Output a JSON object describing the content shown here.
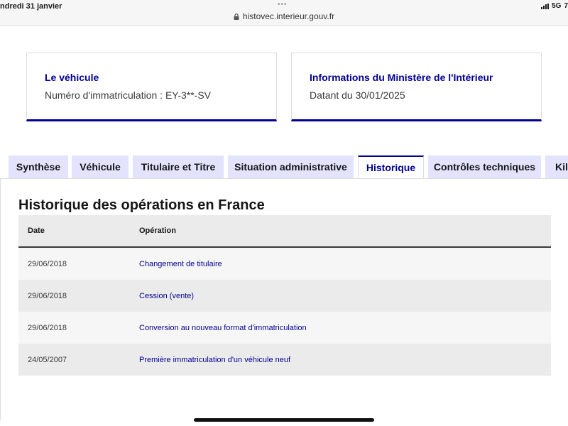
{
  "statusbar": {
    "time": "ndredi 31 janvier",
    "dots": "•••",
    "url": "histovec.interieur.gouv.fr",
    "network": "5G",
    "battery": "7"
  },
  "cards": [
    {
      "title": "Le véhicule",
      "text": "Numéro d'immatriculation : EY-3**-SV"
    },
    {
      "title": "Informations du Ministère de l'Intérieur",
      "text": "Datant du 30/01/2025"
    }
  ],
  "tabs": [
    {
      "label": "Synthèse",
      "active": false
    },
    {
      "label": "Véhicule",
      "active": false
    },
    {
      "label": "Titulaire et Titre",
      "active": false
    },
    {
      "label": "Situation administrative",
      "active": false
    },
    {
      "label": "Historique",
      "active": true
    },
    {
      "label": "Contrôles techniques",
      "active": false
    },
    {
      "label": "Kil",
      "active": false
    }
  ],
  "section": {
    "title": "Historique des opérations en France",
    "columns": [
      "Date",
      "Opération"
    ],
    "rows": [
      {
        "date": "29/06/2018",
        "operation": "Changement de titulaire"
      },
      {
        "date": "29/06/2018",
        "operation": "Cession (vente)"
      },
      {
        "date": "29/06/2018",
        "operation": "Conversion au nouveau format d'immatriculation"
      },
      {
        "date": "24/05/2007",
        "operation": "Première immatriculation d'un véhicule neuf"
      }
    ]
  },
  "colors": {
    "accent": "#000091",
    "tab_inactive": "#e3e3fd",
    "row_light": "#f6f6f6",
    "row_dark": "#ebebeb"
  },
  "icons": [
    "lock-icon",
    "signal-icon"
  ]
}
